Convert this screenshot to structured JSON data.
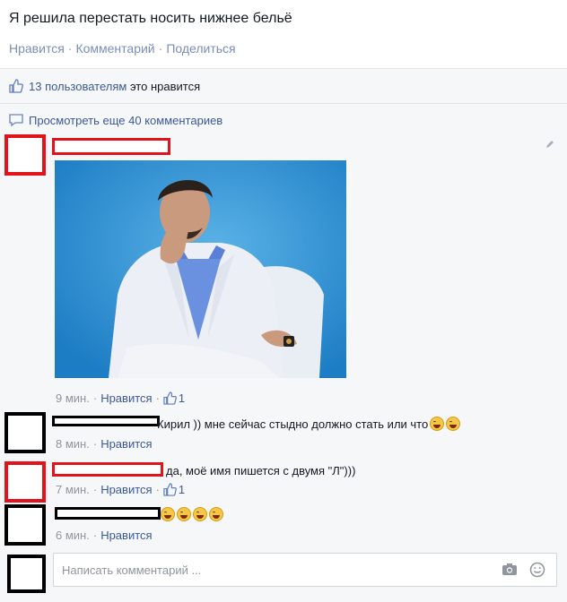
{
  "post": {
    "text": "Я решила перестать носить нижнее бельё",
    "actions": {
      "like": "Нравится",
      "comment": "Комментарий",
      "share": "Поделиться",
      "separator": "·"
    }
  },
  "feedback": {
    "likes_count_text": "13 пользователям",
    "likes_suffix": " это нравится",
    "view_more": "Просмотреть еще 40 комментариев"
  },
  "comments": [
    {
      "text": "",
      "time": "9 мин.",
      "like": "Нравится",
      "like_count": "1",
      "has_photo": true
    },
    {
      "text": "Кирил )) мне сейчас стыдно должно стать или что",
      "time": "8 мин.",
      "like": "Нравится"
    },
    {
      "text": "да, моё имя пишется с двумя \"Л\")))",
      "time": "7 мин.",
      "like": "Нравится",
      "like_count": "1"
    },
    {
      "text": "",
      "time": "6 мин.",
      "like": "Нравится"
    }
  ],
  "composer": {
    "placeholder": "Написать комментарий ..."
  },
  "colors": {
    "link": "#3b5998",
    "redaction_red": "#e3131b",
    "redaction_black": "#000000",
    "feedback_bg": "#f6f7f9"
  }
}
